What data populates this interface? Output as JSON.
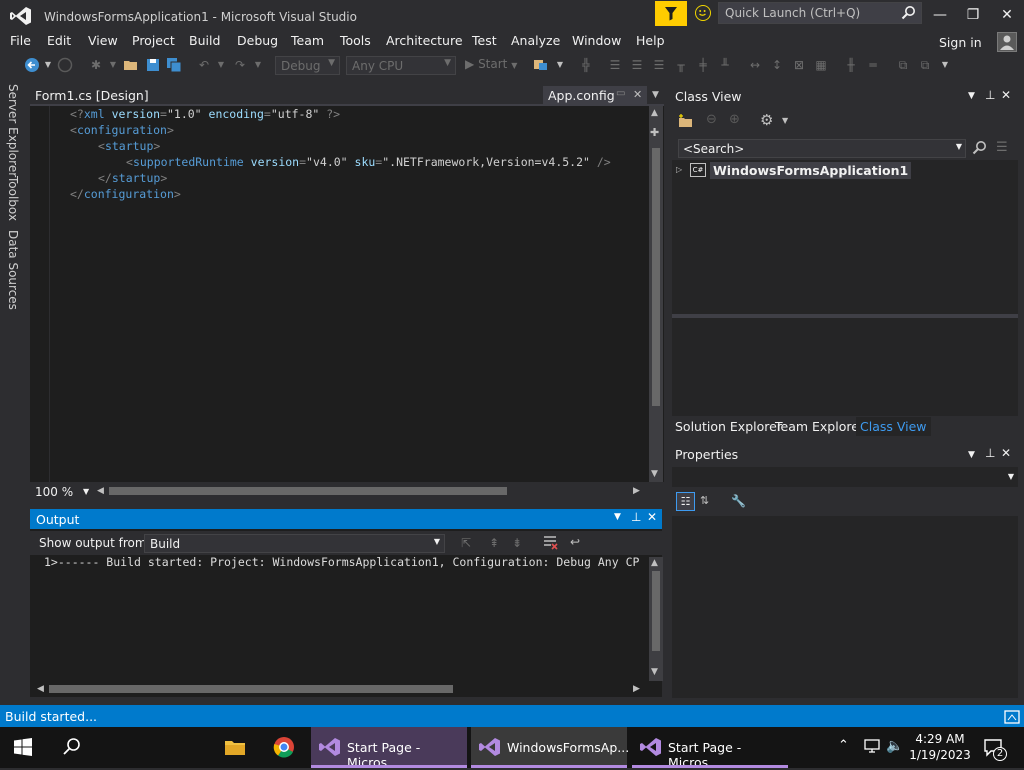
{
  "window": {
    "title": "WindowsFormsApplication1 - Microsoft Visual Studio",
    "quick_launch_placeholder": "Quick Launch (Ctrl+Q)",
    "sign_in": "Sign in"
  },
  "menu": [
    "File",
    "Edit",
    "View",
    "Project",
    "Build",
    "Debug",
    "Team",
    "Tools",
    "Architecture",
    "Test",
    "Analyze",
    "Window",
    "Help"
  ],
  "toolbar": {
    "config": "Debug",
    "platform": "Any CPU",
    "start": "Start"
  },
  "side_tabs": [
    "Server Explorer",
    "Toolbox",
    "Data Sources"
  ],
  "doc_tabs": {
    "form_tab": "Form1.cs [Design]",
    "active_tab": "App.config"
  },
  "editor": {
    "zoom": "100 %",
    "lines": [
      {
        "indent": 0,
        "parts": [
          [
            "punct",
            "<?"
          ],
          [
            "tag",
            "xml"
          ],
          [
            "attr",
            " version"
          ],
          [
            "punct",
            "="
          ],
          [
            "val",
            "\"1.0\""
          ],
          [
            "attr",
            " encoding"
          ],
          [
            "punct",
            "="
          ],
          [
            "val",
            "\"utf-8\""
          ],
          [
            "punct",
            " ?>"
          ]
        ]
      },
      {
        "indent": 0,
        "parts": [
          [
            "punct",
            "<"
          ],
          [
            "tag",
            "configuration"
          ],
          [
            "punct",
            ">"
          ]
        ]
      },
      {
        "indent": 1,
        "parts": [
          [
            "punct",
            "<"
          ],
          [
            "tag",
            "startup"
          ],
          [
            "punct",
            ">"
          ]
        ]
      },
      {
        "indent": 2,
        "parts": [
          [
            "punct",
            "<"
          ],
          [
            "tag",
            "supportedRuntime"
          ],
          [
            "attr",
            " version"
          ],
          [
            "punct",
            "="
          ],
          [
            "val",
            "\"v4.0\""
          ],
          [
            "attr",
            " sku"
          ],
          [
            "punct",
            "="
          ],
          [
            "val",
            "\".NETFramework,Version=v4.5.2\""
          ],
          [
            "punct",
            " />"
          ]
        ]
      },
      {
        "indent": 1,
        "parts": [
          [
            "punct",
            "</"
          ],
          [
            "tag",
            "startup"
          ],
          [
            "punct",
            ">"
          ]
        ]
      },
      {
        "indent": 0,
        "parts": [
          [
            "punct",
            "</"
          ],
          [
            "tag",
            "configuration"
          ],
          [
            "punct",
            ">"
          ]
        ]
      }
    ]
  },
  "output": {
    "title": "Output",
    "show_from_label": "Show output from:",
    "source": "Build",
    "text": "1>------ Build started: Project: WindowsFormsApplication1, Configuration: Debug Any CP"
  },
  "class_view": {
    "title": "Class View",
    "search_placeholder": "<Search>",
    "root_node": "WindowsFormsApplication1"
  },
  "bottom_tabs": [
    "Solution Explorer",
    "Team Explorer",
    "Class View"
  ],
  "properties": {
    "title": "Properties"
  },
  "status": {
    "text": "Build started..."
  },
  "taskbar": {
    "items": [
      "Start Page - Micros...",
      "WindowsFormsAp...",
      "Start Page - Micros..."
    ],
    "time": "4:29 AM",
    "date": "1/19/2023",
    "notification_count": "2"
  },
  "colors": {
    "accent": "#007acc",
    "editor_bg": "#1e1e1e",
    "chrome_bg": "#2d2d30",
    "filter_yellow": "#ffcc00",
    "vs_purple": "#865fc5"
  }
}
